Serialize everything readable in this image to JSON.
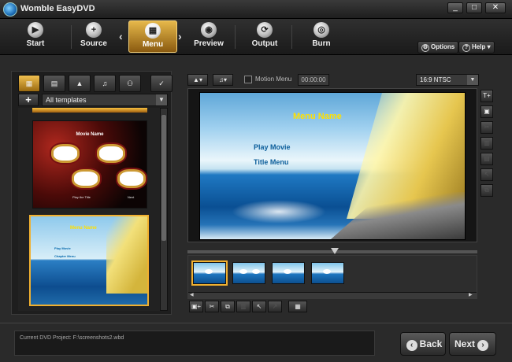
{
  "window": {
    "title": "Womble EasyDVD",
    "buttons": [
      "_",
      "□",
      "✕"
    ]
  },
  "toolbar": {
    "steps": [
      {
        "label": "Start",
        "icon": "play-icon",
        "glyph": "▶"
      },
      {
        "label": "Source",
        "icon": "add-icon",
        "glyph": "+"
      },
      {
        "label": "Menu",
        "icon": "menu-grid-icon",
        "glyph": "▦",
        "active": true
      },
      {
        "label": "Preview",
        "icon": "eye-icon",
        "glyph": "◉"
      },
      {
        "label": "Output",
        "icon": "output-icon",
        "glyph": "⟳"
      },
      {
        "label": "Burn",
        "icon": "disc-icon",
        "glyph": "◎"
      }
    ],
    "prev_arrow": "‹",
    "next_arrow": "›",
    "options_label": "Options",
    "help_label": "Help"
  },
  "templates": {
    "tabs": [
      "▦",
      "▤",
      "▲",
      "♫",
      "⚇",
      "✓"
    ],
    "filter_value": "All templates",
    "plus_label": "+",
    "items": [
      {
        "title": "Movie Name",
        "item1": "Play the Title",
        "item2": "Next"
      },
      {
        "title": "Menu Name",
        "item1": "Play Movie",
        "item2": "Chapter Menu"
      }
    ]
  },
  "editor": {
    "motion_menu_label": "Motion Menu",
    "duration": "00:00:00",
    "aspect_value": "16:9 NTSC",
    "menu_title": "Menu Name",
    "menu_items": [
      "Play Movie",
      "Title Menu"
    ]
  },
  "side_tools": [
    "T+",
    "▣",
    "✂",
    "▥",
    "▤",
    "↖",
    "⧉"
  ],
  "bottom_tools": [
    "▣+",
    "✂",
    "⧉",
    "▥",
    "↖",
    "↗",
    "▦"
  ],
  "status": {
    "project_text": "Current DVD Project: F:\\screenshots2.wbd"
  },
  "nav": {
    "back_label": "Back",
    "next_label": "Next"
  }
}
